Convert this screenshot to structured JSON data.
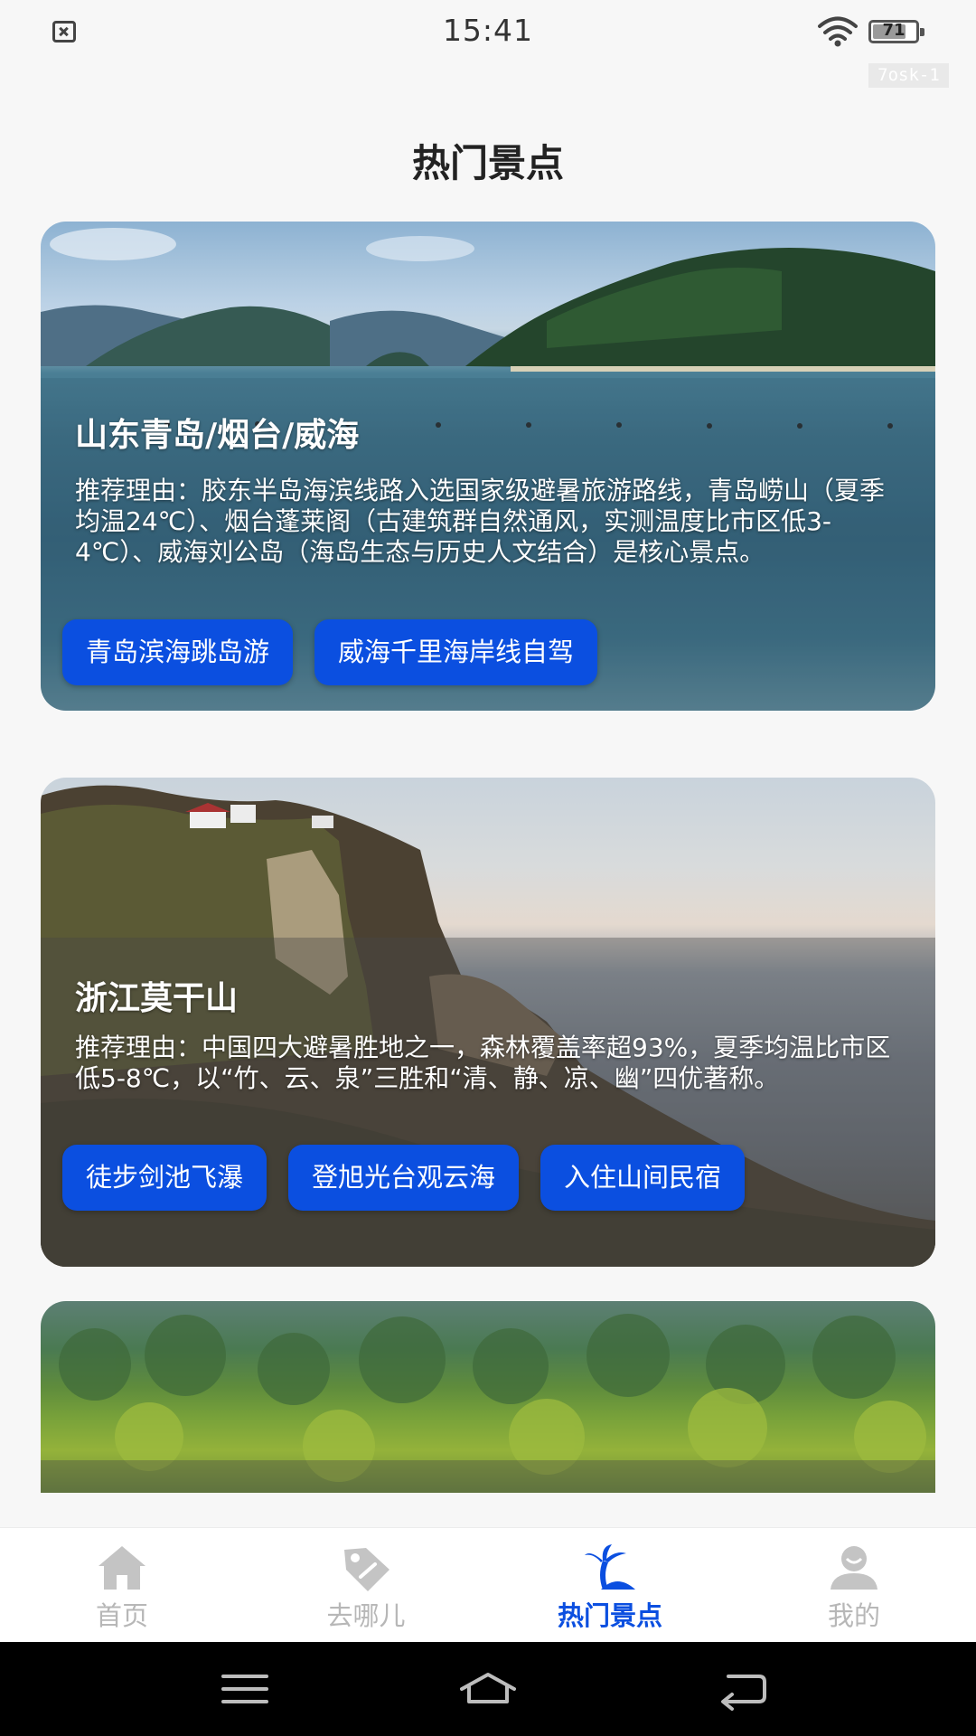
{
  "status_bar": {
    "time": "15:41",
    "battery": "71",
    "battery_level": 0.71,
    "device_tag": "7osk-1"
  },
  "page": {
    "title": "热门景点"
  },
  "cards": [
    {
      "name": "山东青岛/烟台/威海",
      "reason": "推荐理由：胶东半岛海滨线路入选国家级避暑旅游路线，青岛崂山（夏季均温24℃）、烟台蓬莱阁（古建筑群自然通风，实测温度比市区低3-4℃）、威海刘公岛（海岛生态与历史人文结合）是核心景点。",
      "tags": [
        "青岛滨海跳岛游",
        "威海千里海岸线自驾"
      ]
    },
    {
      "name": "浙江莫干山",
      "reason": "推荐理由：中国四大避暑胜地之一，森林覆盖率超93%，夏季均温比市区低5-8℃，以“竹、云、泉”三胜和“清、静、凉、幽”四优著称。",
      "tags": [
        "徒步剑池飞瀑",
        "登旭光台观云海",
        "入住山间民宿"
      ]
    }
  ],
  "bottom_nav": {
    "items": [
      {
        "label": "首页",
        "icon": "home-icon"
      },
      {
        "label": "去哪儿",
        "icon": "tag-icon"
      },
      {
        "label": "热门景点",
        "icon": "palm-island-icon"
      },
      {
        "label": "我的",
        "icon": "user-icon"
      }
    ],
    "active_index": 2
  },
  "colors": {
    "accent": "#0b4fe0",
    "inactive": "#b7b7b7",
    "background": "#f7f7f7"
  }
}
